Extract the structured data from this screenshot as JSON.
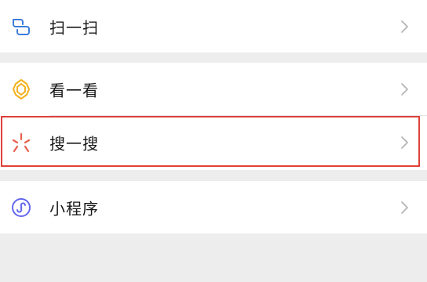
{
  "menu": {
    "items": [
      {
        "label": "扫一扫",
        "icon": "scan-icon"
      },
      {
        "label": "看一看",
        "icon": "top-stories-icon"
      },
      {
        "label": "搜一搜",
        "icon": "search-sparkle-icon"
      },
      {
        "label": "小程序",
        "icon": "mini-program-icon"
      }
    ]
  },
  "colors": {
    "background": "#ededed",
    "row": "#ffffff",
    "scan": "#3b7ddd",
    "top_stories": "#f2b11c",
    "search": "#e8604c",
    "mini_program": "#6467f0",
    "highlight": "#e0403a",
    "chevron": "#b2b2b2"
  }
}
